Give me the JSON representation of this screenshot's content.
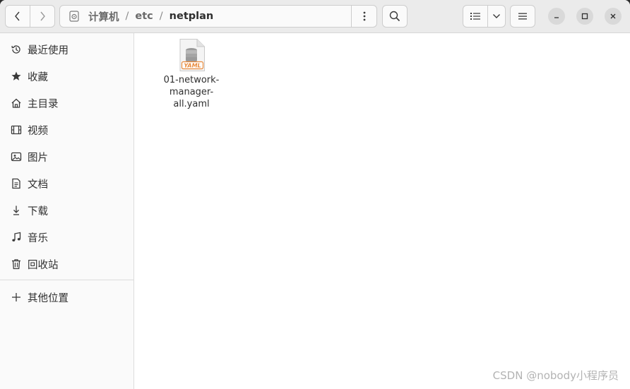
{
  "path": {
    "crumbs": [
      "计算机",
      "etc",
      "netplan"
    ],
    "separator": "/"
  },
  "sidebar": {
    "items": [
      {
        "label": "最近使用",
        "icon": "recent-icon"
      },
      {
        "label": "收藏",
        "icon": "star-icon"
      },
      {
        "label": "主目录",
        "icon": "home-icon"
      },
      {
        "label": "视频",
        "icon": "video-icon"
      },
      {
        "label": "图片",
        "icon": "picture-icon"
      },
      {
        "label": "文档",
        "icon": "document-icon"
      },
      {
        "label": "下载",
        "icon": "download-icon"
      },
      {
        "label": "音乐",
        "icon": "music-icon"
      },
      {
        "label": "回收站",
        "icon": "trash-icon"
      }
    ],
    "other": {
      "label": "其他位置",
      "icon": "plus-icon"
    }
  },
  "files": [
    {
      "name": "01-network-manager-all.yaml",
      "icon": "yaml-file-icon",
      "badge": "YAML"
    }
  ],
  "watermark": "CSDN @nobody小程序员",
  "colors": {
    "accent": "#e8893a",
    "window_bg": "#ffffff",
    "header_bg": "#ebebeb"
  }
}
